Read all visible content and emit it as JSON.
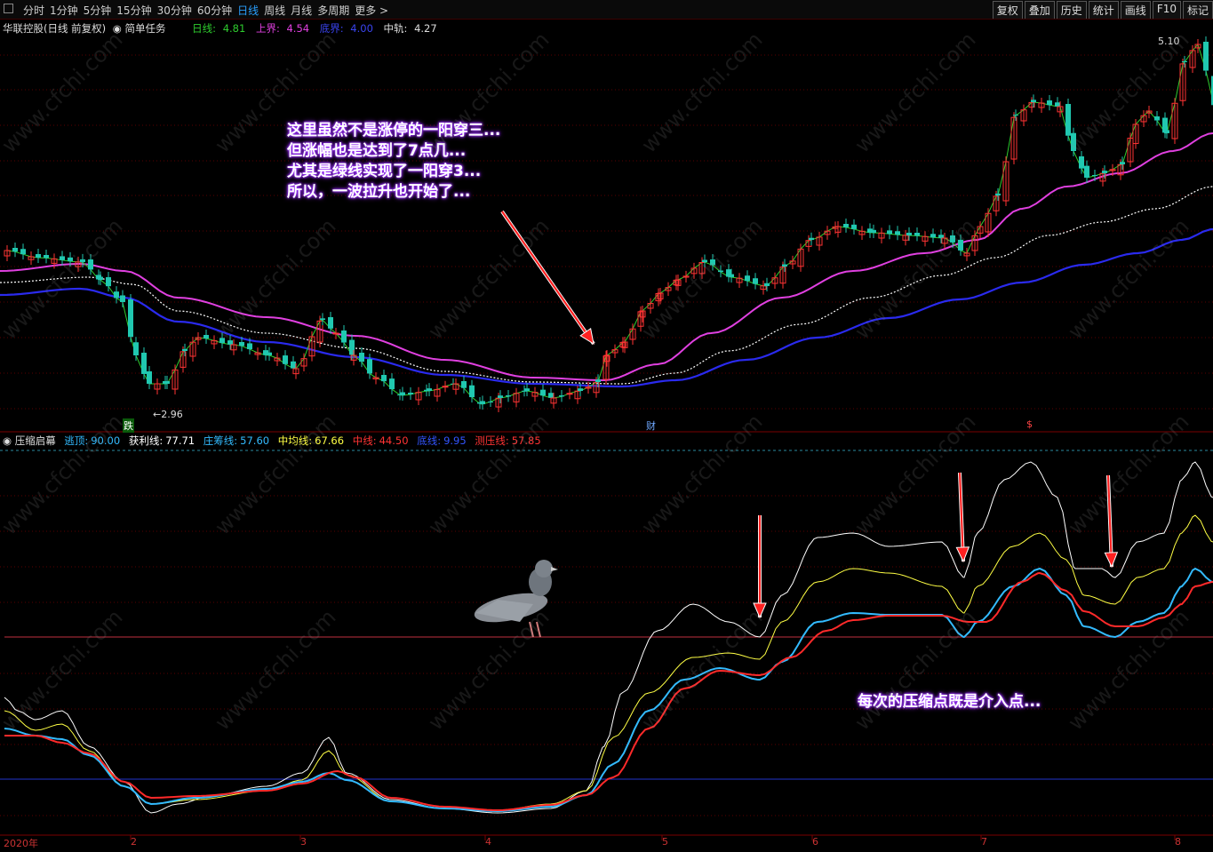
{
  "toolbar": {
    "tabs": [
      "分时",
      "1分钟",
      "5分钟",
      "15分钟",
      "30分钟",
      "60分钟",
      "日线",
      "周线",
      "月线",
      "多周期",
      "更多 >"
    ],
    "active_tab": "日线",
    "tools": [
      "复权",
      "叠加",
      "历史",
      "统计",
      "画线",
      "F10",
      "标记"
    ]
  },
  "main_panel": {
    "stock": "华联控股(日线 前复权)",
    "task": "简单任务",
    "indicators": [
      {
        "label": "日线:",
        "value": "4.81",
        "color": "#2ecc2e"
      },
      {
        "label": "上界:",
        "value": "4.54",
        "color": "#e040e0"
      },
      {
        "label": "底界:",
        "value": "4.00",
        "color": "#2f39e8"
      },
      {
        "label": "中轨:",
        "value": "4.27",
        "color": "#dddddd"
      }
    ],
    "price_high_label": "5.10",
    "price_low_label": "←2.96",
    "event_tags": [
      "跌",
      "财",
      "$"
    ],
    "callout_lines": [
      "这里虽然不是涨停的一阳穿三...",
      "但涨幅也是达到了7点几...",
      "尤其是绿线实现了一阳穿3...",
      "所以，一波拉升也开始了..."
    ]
  },
  "indicator_panel": {
    "name": "压缩启幕",
    "params": [
      {
        "label": "逃顶:",
        "value": "90.00",
        "color": "#33bbff"
      },
      {
        "label": "获利线:",
        "value": "77.71",
        "color": "#ffffff"
      },
      {
        "label": "庄筹线:",
        "value": "57.60",
        "color": "#33bbff"
      },
      {
        "label": "中均线:",
        "value": "67.66",
        "color": "#ffff44"
      },
      {
        "label": "中线:",
        "value": "44.50",
        "color": "#ff3333"
      },
      {
        "label": "底线:",
        "value": "9.95",
        "color": "#3355ff"
      },
      {
        "label": "测压线:",
        "value": "57.85",
        "color": "#ff3333"
      }
    ],
    "callout": "每次的压缩点既是介入点..."
  },
  "x_axis": [
    "2020年",
    "2",
    "3",
    "4",
    "5",
    "6",
    "7",
    "8"
  ],
  "watermark": "www.cfchi.com",
  "colors": {
    "upper": "#e040e0",
    "lower": "#2a2aee",
    "middle": "#ffffff",
    "close_line": "#2ecc2e",
    "up_candle": "#ff3333",
    "down_candle": "#20c8b0",
    "arrow": "#ff2020"
  }
}
